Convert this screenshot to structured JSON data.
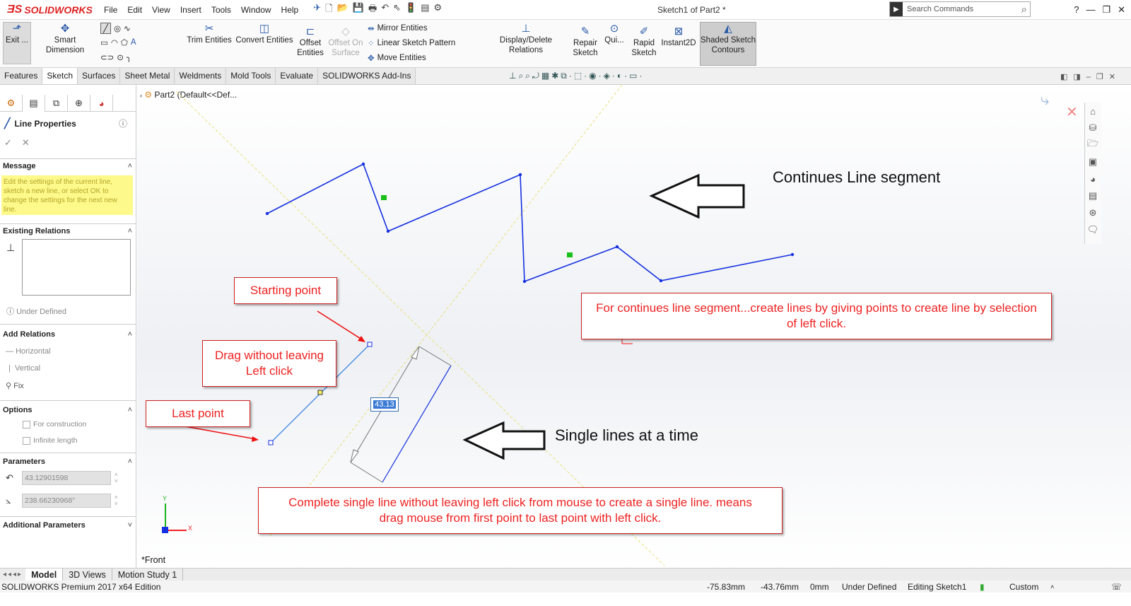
{
  "app": {
    "logo": "SOLIDWORKS",
    "menus": [
      "File",
      "Edit",
      "View",
      "Insert",
      "Tools",
      "Window",
      "Help"
    ],
    "doc_title": "Sketch1 of Part2 *",
    "search_placeholder": "Search Commands"
  },
  "ribbon": {
    "exit": "Exit ...",
    "smart_dimension": "Smart Dimension",
    "trim": "Trim Entities",
    "convert": "Convert Entities",
    "offset": "Offset Entities",
    "offset_surface": "Offset On Surface",
    "mirror": "Mirror Entities",
    "linear_pattern": "Linear Sketch Pattern",
    "move": "Move Entities",
    "display_relations": "Display/Delete Relations",
    "repair": "Repair Sketch",
    "quick": "Qui...",
    "rapid": "Rapid Sketch",
    "instant2d": "Instant2D",
    "shaded": "Shaded Sketch Contours"
  },
  "tabs": [
    "Features",
    "Sketch",
    "Surfaces",
    "Sheet Metal",
    "Weldments",
    "Mold Tools",
    "Evaluate",
    "SOLIDWORKS Add-Ins"
  ],
  "active_tab": "Sketch",
  "panel": {
    "title": "Line Properties",
    "message_header": "Message",
    "message": "Edit the settings of the current line, sketch a new line, or select OK to change the settings for the next new line.",
    "existing_relations": "Existing Relations",
    "under_defined": "Under Defined",
    "add_relations": "Add Relations",
    "horizontal": "Horizontal",
    "vertical": "Vertical",
    "fix": "Fix",
    "options": "Options",
    "for_construction": "For construction",
    "infinite_length": "Infinite length",
    "parameters": "Parameters",
    "length_value": "43.12901598",
    "angle_value": "238.66230968°",
    "additional_parameters": "Additional Parameters"
  },
  "canvas": {
    "tree_label": "Part2  (Default<<Def...",
    "continues_label": "Continues Line segment",
    "single_label": "Single lines at a time",
    "callout_continues": "For continues line segment...create lines by giving points to create line by selection of left click.",
    "callout_start": "Starting point",
    "callout_drag": "Drag without leaving Left click",
    "callout_last": "Last point",
    "callout_single": "Complete single line without leaving left click from mouse to create a single line. means drag mouse from first point to last point with left click.",
    "dimension": "43.13",
    "view_label": "*Front",
    "axis_x": "X",
    "axis_y": "Y"
  },
  "bottom_tabs": [
    "Model",
    "3D Views",
    "Motion Study 1"
  ],
  "status": {
    "edition": "SOLIDWORKS Premium 2017 x64 Edition",
    "x": "-75.83mm",
    "y": "-43.76mm",
    "z": "0mm",
    "state": "Under Defined",
    "editing": "Editing Sketch1",
    "units": "Custom"
  }
}
